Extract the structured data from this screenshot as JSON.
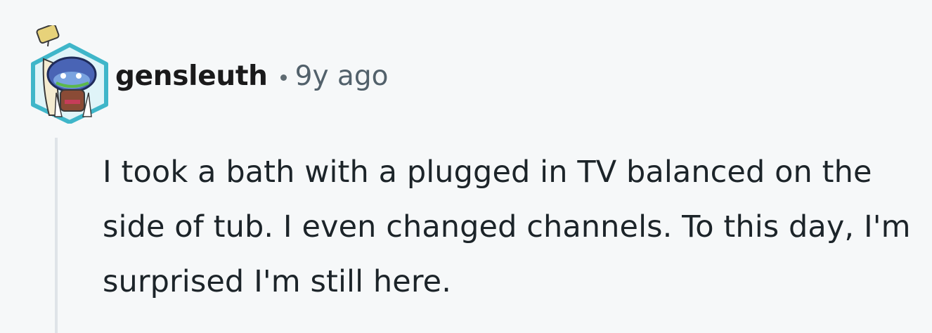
{
  "comment": {
    "author": "gensleuth",
    "separator": "•",
    "timestamp": "9y ago",
    "body": "I took a bath with a plugged in TV balanced on the side of tub. I even changed channels. To this day, I'm surprised I'm still here."
  },
  "avatar": {
    "icon": "user-avatar-icon",
    "hex_border_color": "#3fb6c9",
    "hex_fill_color": "#dff4f8"
  },
  "colors": {
    "background": "#f6f8f9",
    "thread_line": "#dfe4e8",
    "author_text": "#1a1a1b",
    "meta_text": "#52616b",
    "body_text": "#1c2429"
  }
}
